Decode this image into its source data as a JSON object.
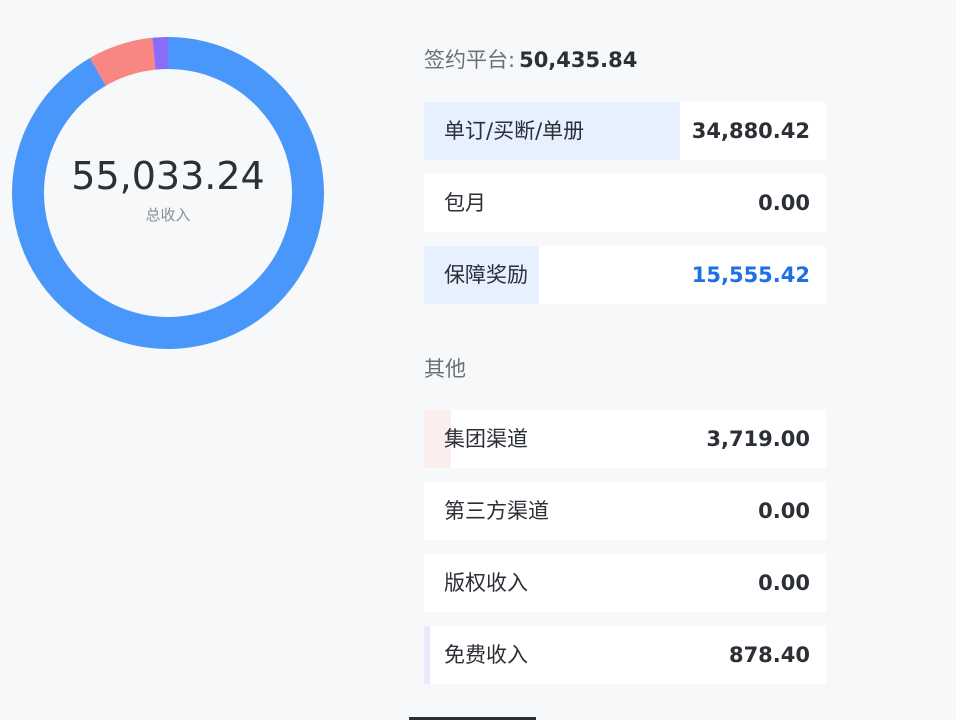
{
  "summary": {
    "total_value": "55,033.24",
    "total_label": "总收入"
  },
  "donut": {
    "segments": [
      {
        "name": "blue",
        "value": 50435.84,
        "color": "#4a97fb"
      },
      {
        "name": "red",
        "value": 3719.0,
        "color": "#f88683"
      },
      {
        "name": "purple",
        "value": 878.4,
        "color": "#8a6cf9"
      }
    ]
  },
  "signed_platform": {
    "title_label": "签约平台:",
    "title_value": "50,435.84",
    "rows": [
      {
        "label": "单订/买断/单册",
        "value": "34,880.42",
        "fill": 0.637,
        "fill_color": "#e7f0fe",
        "accent": false
      },
      {
        "label": "包月",
        "value": "0.00",
        "fill": 0,
        "fill_color": "#e7f0fe",
        "accent": false
      },
      {
        "label": "保障奖励",
        "value": "15,555.42",
        "fill": 0.286,
        "fill_color": "#e7f0fe",
        "accent": true
      }
    ]
  },
  "other": {
    "title_label": "其他",
    "rows": [
      {
        "label": "集团渠道",
        "value": "3,719.00",
        "fill": 0.068,
        "fill_color": "#fdeeee",
        "accent": false
      },
      {
        "label": "第三方渠道",
        "value": "0.00",
        "fill": 0,
        "fill_color": "#fdeeee",
        "accent": false
      },
      {
        "label": "版权收入",
        "value": "0.00",
        "fill": 0,
        "fill_color": "#fdeeee",
        "accent": false
      },
      {
        "label": "免费收入",
        "value": "878.40",
        "fill": 0.016,
        "fill_color": "#ece8fd",
        "accent": false
      }
    ]
  }
}
